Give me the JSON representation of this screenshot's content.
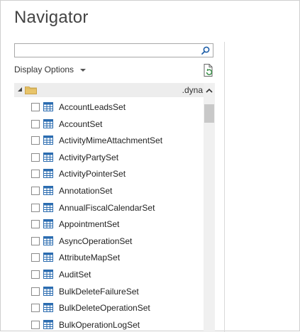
{
  "window": {
    "title": "Navigator"
  },
  "search": {
    "value": "",
    "placeholder": ""
  },
  "display_options": {
    "label": "Display Options"
  },
  "tree": {
    "root": {
      "label": ".dyna",
      "expanded": true
    },
    "items": [
      {
        "label": "AccountLeadsSet",
        "checked": false
      },
      {
        "label": "AccountSet",
        "checked": false
      },
      {
        "label": "ActivityMimeAttachmentSet",
        "checked": false
      },
      {
        "label": "ActivityPartySet",
        "checked": false
      },
      {
        "label": "ActivityPointerSet",
        "checked": false
      },
      {
        "label": "AnnotationSet",
        "checked": false
      },
      {
        "label": "AnnualFiscalCalendarSet",
        "checked": false
      },
      {
        "label": "AppointmentSet",
        "checked": false
      },
      {
        "label": "AsyncOperationSet",
        "checked": false
      },
      {
        "label": "AttributeMapSet",
        "checked": false
      },
      {
        "label": "AuditSet",
        "checked": false
      },
      {
        "label": "BulkDeleteFailureSet",
        "checked": false
      },
      {
        "label": "BulkDeleteOperationSet",
        "checked": false
      },
      {
        "label": "BulkOperationLogSet",
        "checked": false
      }
    ]
  },
  "colors": {
    "accent": "#1f5fa8",
    "table_icon": "#2b6cb0",
    "folder": "#e8c46a"
  },
  "icons": {
    "search": "search-icon",
    "refresh": "refresh-icon",
    "folder": "folder-icon",
    "table": "table-icon"
  }
}
